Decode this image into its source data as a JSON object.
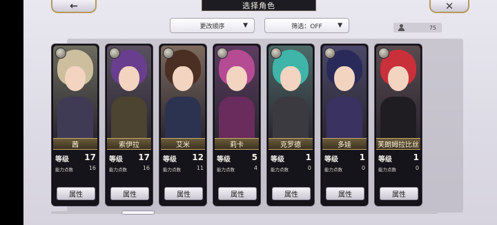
{
  "header": {
    "back_label": "←",
    "title": "选择角色",
    "close_label": "✕"
  },
  "controls": {
    "sort_label": "更改顺序",
    "filter_label": "筛选：OFF",
    "caret": "▼",
    "count": "75"
  },
  "stat_labels": {
    "level": "等级",
    "ability_points": "能力点数",
    "attr_button": "属性"
  },
  "characters": [
    {
      "name": "茜",
      "level": "17",
      "points": "16",
      "hair": "#cdbf9e",
      "body": "#403b55",
      "bg": "#6c6b5e",
      "icon": "sword-icon"
    },
    {
      "name": "索伊拉",
      "level": "17",
      "points": "16",
      "hair": "#6a3e8e",
      "body": "#4c4330",
      "bg": "#5a5160",
      "icon": "sword-icon"
    },
    {
      "name": "艾米",
      "level": "12",
      "points": "11",
      "hair": "#4a2f22",
      "body": "#2c3350",
      "bg": "#7d6a5e",
      "icon": "sword-icon"
    },
    {
      "name": "莉卡",
      "level": "5",
      "points": "4",
      "hair": "#b54b93",
      "body": "#6a2c5c",
      "bg": "#5c3c61",
      "icon": "sword-icon"
    },
    {
      "name": "克罗德",
      "level": "1",
      "points": "0",
      "hair": "#3fb4a8",
      "body": "#3b3a40",
      "bg": "#4d6a67",
      "icon": "sword-icon"
    },
    {
      "name": "多娃",
      "level": "1",
      "points": "0",
      "hair": "#2a2a5a",
      "body": "#3a3260",
      "bg": "#4a4768",
      "icon": "spiral-icon"
    },
    {
      "name": "芙朗姆拉比丝",
      "level": "1",
      "points": "0",
      "hair": "#c9303a",
      "body": "#1f1d22",
      "bg": "#5a4a50",
      "icon": "spiral-icon"
    }
  ]
}
